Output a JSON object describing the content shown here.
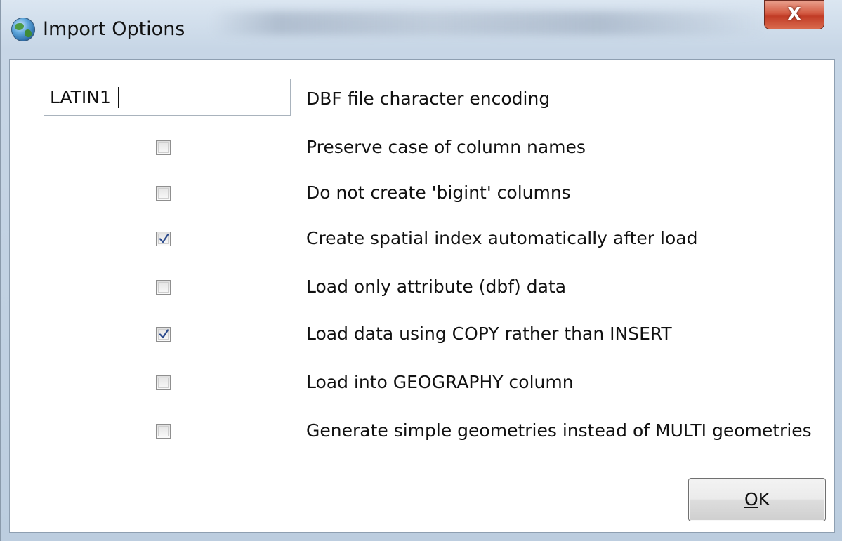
{
  "window": {
    "title": "Import Options",
    "close_label": "X"
  },
  "encoding": {
    "value": "LATIN1",
    "label": "DBF file character encoding"
  },
  "options": [
    {
      "label": "Preserve case of column names",
      "checked": false
    },
    {
      "label": "Do not create 'bigint' columns",
      "checked": false
    },
    {
      "label": "Create spatial index automatically after load",
      "checked": true
    },
    {
      "label": "Load only attribute (dbf) data",
      "checked": false
    },
    {
      "label": "Load data using COPY rather than INSERT",
      "checked": true
    },
    {
      "label": "Load into GEOGRAPHY column",
      "checked": false
    },
    {
      "label": "Generate simple geometries instead of MULTI geometries",
      "checked": false
    }
  ],
  "buttons": {
    "ok_mnemonic": "O",
    "ok_rest": "K"
  },
  "colors": {
    "check_mark": "#2b4a8c",
    "close_button": "#c13c26"
  }
}
